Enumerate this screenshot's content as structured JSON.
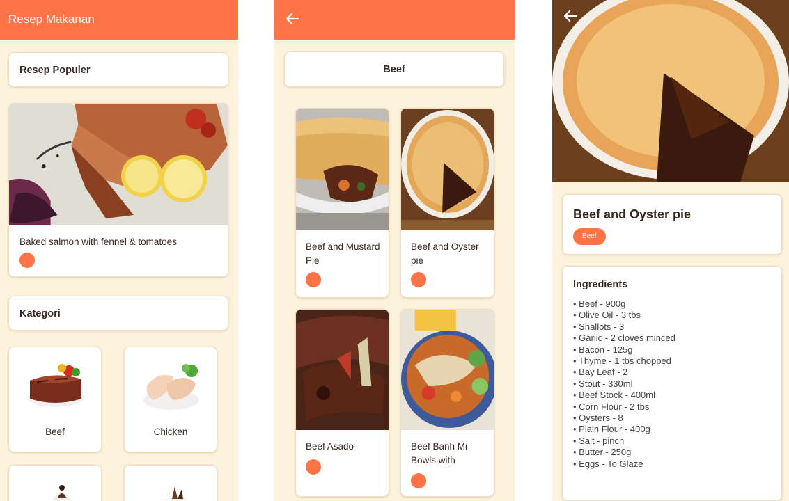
{
  "screen1": {
    "app_title": "Resep Makanan",
    "popular_title": "Resep Populer",
    "popular_recipe": {
      "name": "Baked salmon with fennel & tomatoes"
    },
    "category_title": "Kategori",
    "categories": [
      {
        "name": "Beef"
      },
      {
        "name": "Chicken"
      }
    ]
  },
  "screen2": {
    "category_header": "Beef",
    "recipes": [
      {
        "name": "Beef and Mustard Pie"
      },
      {
        "name": "Beef and Oyster pie"
      },
      {
        "name": "Beef Asado"
      },
      {
        "name": "Beef Banh Mi Bowls with"
      }
    ]
  },
  "screen3": {
    "recipe_name": "Beef and Oyster pie",
    "category_tag": "Beef",
    "ingredients_title": "Ingredients",
    "ingredients": [
      "Beef - 900g",
      "Olive Oil - 3 tbs",
      "Shallots - 3",
      "Garlic - 2 cloves minced",
      "Bacon - 125g",
      "Thyme - 1 tbs chopped",
      "Bay Leaf - 2",
      "Stout - 330ml",
      "Beef Stock - 400ml",
      "Corn Flour - 2 tbs",
      "Oysters - 8",
      "Plain Flour - 400g",
      "Salt - pinch",
      "Butter - 250g",
      "Eggs - To Glaze"
    ]
  },
  "colors": {
    "accent": "#ff7447",
    "background": "#fdf3dc",
    "card": "#ffffff",
    "text": "#3b2a22"
  },
  "icons": {
    "back": "arrow-left-icon",
    "favorite_dot": "circle-icon"
  }
}
